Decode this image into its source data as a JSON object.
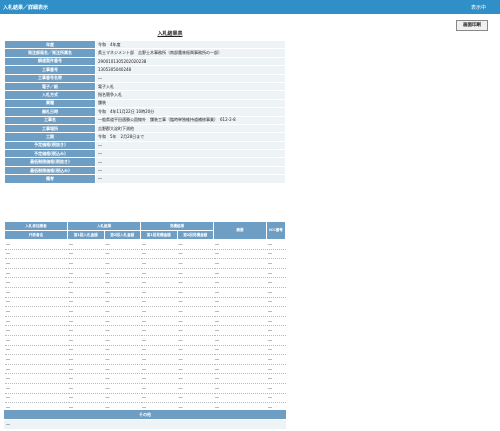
{
  "header": {
    "title": "入札結果／詳細表示",
    "right_label": "表示中"
  },
  "print_button": "画面印刷",
  "doc_title": "入札結果表",
  "info_rows": [
    {
      "label": "年度",
      "value": "令和　4年度"
    },
    {
      "label": "発注部局名／発注所属名",
      "value": "県土マネジメント部　吉野土木事務所（南部農林振興事務所の一部）"
    },
    {
      "label": "調達案件番号",
      "value": "2900101305202020238"
    },
    {
      "label": "工事番号",
      "value": "1305305040248"
    },
    {
      "label": "工事番号名称",
      "value": "―"
    },
    {
      "label": "電子／紙",
      "value": "電子入札"
    },
    {
      "label": "入札方式",
      "value": "指名競争入札"
    },
    {
      "label": "業種",
      "value": "舗装"
    },
    {
      "label": "開札日時",
      "value": "令和　4年11月22日 10時20分"
    },
    {
      "label": "工事名",
      "value": "一般県道平田邁勝公園線外　舗装工事（臨時単独維持道補修事業）　612-2-8"
    },
    {
      "label": "工事場所",
      "value": "吉野郡大淀町下渕他"
    },
    {
      "label": "工期",
      "value": "令和　5年　2月28日まで"
    },
    {
      "label": "予定価格(税抜き)",
      "value": "―"
    },
    {
      "label": "予定価格(税込み)",
      "value": "―"
    },
    {
      "label": "最低制限価格(税抜き)",
      "value": "―"
    },
    {
      "label": "最低制限価格(税込み)",
      "value": "―"
    },
    {
      "label": "備考",
      "value": "―"
    }
  ],
  "bid_table": {
    "headers_top": [
      "入札参加業者",
      "入札結果",
      "見積結果",
      "摘要",
      "ICC番号"
    ],
    "headers_sub": [
      "代表者名",
      "第1回入札金額",
      "第2回入札金額",
      "第1回見積金額",
      "第2回見積金額"
    ],
    "rows": [
      [
        "―",
        "―",
        "―",
        "―",
        "―",
        "―",
        "―"
      ],
      [
        "―",
        "―",
        "―",
        "―",
        "―",
        "―",
        "―"
      ],
      [
        "―",
        "―",
        "―",
        "―",
        "―",
        "―",
        "―"
      ],
      [
        "―",
        "―",
        "―",
        "―",
        "―",
        "―",
        "―"
      ],
      [
        "―",
        "―",
        "―",
        "―",
        "―",
        "―",
        "―"
      ],
      [
        "―",
        "―",
        "―",
        "―",
        "―",
        "―",
        "―"
      ],
      [
        "―",
        "―",
        "―",
        "―",
        "―",
        "―",
        "―"
      ],
      [
        "―",
        "―",
        "―",
        "―",
        "―",
        "―",
        "―"
      ],
      [
        "―",
        "―",
        "―",
        "―",
        "―",
        "―",
        "―"
      ],
      [
        "―",
        "―",
        "―",
        "―",
        "―",
        "―",
        "―"
      ],
      [
        "―",
        "―",
        "―",
        "―",
        "―",
        "―",
        "―"
      ],
      [
        "―",
        "―",
        "―",
        "―",
        "―",
        "―",
        "―"
      ],
      [
        "―",
        "―",
        "―",
        "―",
        "―",
        "―",
        "―"
      ],
      [
        "―",
        "―",
        "―",
        "―",
        "―",
        "―",
        "―"
      ],
      [
        "―",
        "―",
        "―",
        "―",
        "―",
        "―",
        "―"
      ],
      [
        "―",
        "―",
        "―",
        "―",
        "―",
        "―",
        "―"
      ],
      [
        "―",
        "―",
        "―",
        "―",
        "―",
        "―",
        "―"
      ],
      [
        "―",
        "―",
        "―",
        "―",
        "―",
        "―",
        "―"
      ],
      [
        "―",
        "―",
        "―",
        "―",
        "―",
        "―",
        "―"
      ]
    ]
  },
  "other": {
    "label": "その他",
    "value": "―"
  }
}
